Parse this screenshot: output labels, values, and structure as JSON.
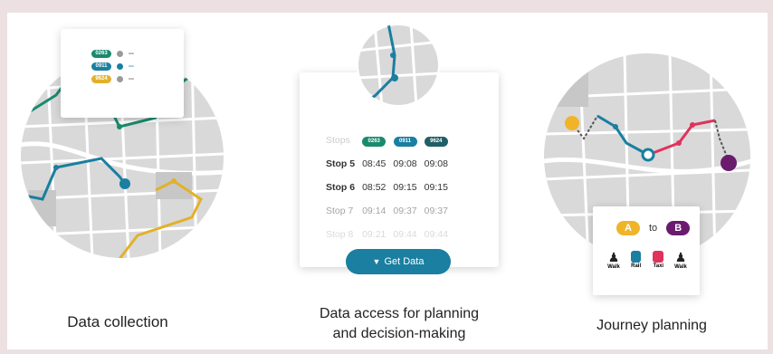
{
  "captions": {
    "collection": "Data collection",
    "access_line1": "Data access for planning",
    "access_line2": "and decision-making",
    "journey": "Journey planning"
  },
  "legend": {
    "routes": [
      {
        "code": "0263",
        "color": "#1a8a6e",
        "dot": "#9a9a9a"
      },
      {
        "code": "0911",
        "color": "#1a7fa0",
        "dot": "#1a7fa0"
      },
      {
        "code": "9624",
        "color": "#e2b12a",
        "dot": "#9a9a9a"
      }
    ]
  },
  "timetable": {
    "header_label": "Stops",
    "routes": [
      {
        "code": "0263",
        "color": "#1a8a6e"
      },
      {
        "code": "0911",
        "color": "#1a7fa0"
      },
      {
        "code": "9624",
        "color": "#1f5f66"
      }
    ],
    "rows": [
      {
        "stop": "Stop 5",
        "times": [
          "08:45",
          "09:08",
          "09:08"
        ]
      },
      {
        "stop": "Stop 6",
        "times": [
          "08:52",
          "09:15",
          "09:15"
        ]
      },
      {
        "stop": "Stop 7",
        "times": [
          "09:14",
          "09:37",
          "09:37"
        ]
      },
      {
        "stop": "Stop 8",
        "times": [
          "09:21",
          "09:44",
          "09:44"
        ]
      }
    ],
    "button_label": "Get Data"
  },
  "journey": {
    "from": "A",
    "to_word": "to",
    "to": "B",
    "modes": [
      "Walk",
      "Rail",
      "Taxi",
      "Walk"
    ],
    "colors": {
      "a": "#f0b429",
      "b": "#6a1b6e",
      "rail": "#1a7fa0",
      "taxi": "#e0335c",
      "walk": "#222222"
    }
  }
}
